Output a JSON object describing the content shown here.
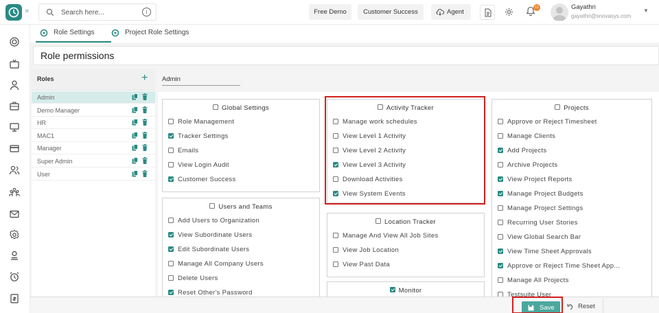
{
  "topbar": {
    "search_placeholder": "Search here...",
    "free_demo": "Free Demo",
    "customer_success": "Customer Success",
    "agent": "Agent",
    "notifications_count": "11",
    "user_name": "Gayathri",
    "user_email": "gayathri@snovasys.com"
  },
  "tabs": [
    {
      "label": "Role Settings"
    },
    {
      "label": "Project Role Settings"
    }
  ],
  "page_title": "Role permissions",
  "roles": {
    "header": "Roles",
    "add": "+",
    "items": [
      {
        "name": "Admin"
      },
      {
        "name": "Demo Manager"
      },
      {
        "name": "HR"
      },
      {
        "name": "MAC1"
      },
      {
        "name": "Manager"
      },
      {
        "name": "Super Admin"
      },
      {
        "name": "User"
      }
    ]
  },
  "selected_role": "Admin",
  "cards": {
    "global": {
      "title": "Global Settings",
      "checked": false,
      "items": [
        {
          "label": "Role Management",
          "checked": false
        },
        {
          "label": "Tracker Settings",
          "checked": true
        },
        {
          "label": "Emails",
          "checked": false
        },
        {
          "label": "View Login Audit",
          "checked": false
        },
        {
          "label": "Customer Success",
          "checked": true
        }
      ]
    },
    "users": {
      "title": "Users and Teams",
      "checked": false,
      "items": [
        {
          "label": "Add Users to Organization",
          "checked": false
        },
        {
          "label": "View Subordinate Users",
          "checked": true
        },
        {
          "label": "Edit Subordinate Users",
          "checked": true
        },
        {
          "label": "Manage All Company Users",
          "checked": false
        },
        {
          "label": "Delete Users",
          "checked": false
        },
        {
          "label": "Reset Other's Password",
          "checked": true
        }
      ]
    },
    "activity": {
      "title": "Activity Tracker",
      "checked": false,
      "items": [
        {
          "label": "Manage work schedules",
          "checked": false
        },
        {
          "label": "View Level 1 Activity",
          "checked": false
        },
        {
          "label": "View Level 2 Activity",
          "checked": false
        },
        {
          "label": "View Level 3 Activity",
          "checked": true
        },
        {
          "label": "Download Activities",
          "checked": false
        },
        {
          "label": "View System Events",
          "checked": true
        }
      ]
    },
    "location": {
      "title": "Location Tracker",
      "checked": false,
      "items": [
        {
          "label": "Manage And View All Job Sites",
          "checked": false
        },
        {
          "label": "View Job Location",
          "checked": false
        },
        {
          "label": "View Past Data",
          "checked": false
        }
      ]
    },
    "monitor": {
      "title": "Monitor",
      "checked": true,
      "items": []
    },
    "projects": {
      "title": "Projects",
      "checked": false,
      "items": [
        {
          "label": "Approve or Reject Timesheet",
          "checked": false
        },
        {
          "label": "Manage Clients",
          "checked": false
        },
        {
          "label": "Add Projects",
          "checked": true
        },
        {
          "label": "Archive Projects",
          "checked": false
        },
        {
          "label": "View Project Reports",
          "checked": true
        },
        {
          "label": "Manage Project Budgets",
          "checked": true
        },
        {
          "label": "Manage Project Settings",
          "checked": false
        },
        {
          "label": "Recurring User Stories",
          "checked": false
        },
        {
          "label": "View Global Search Bar",
          "checked": false
        },
        {
          "label": "View Time Sheet Approvals",
          "checked": true
        },
        {
          "label": "Approve or Reject Time Sheet App...",
          "checked": true
        },
        {
          "label": "Manage All Projects",
          "checked": false
        },
        {
          "label": "Testsuite User",
          "checked": false
        }
      ]
    }
  },
  "footer": {
    "save": "Save",
    "reset": "Reset"
  },
  "colors": {
    "accent": "#2a8a84",
    "save": "#4ba89e",
    "highlight": "#d21f1f"
  }
}
